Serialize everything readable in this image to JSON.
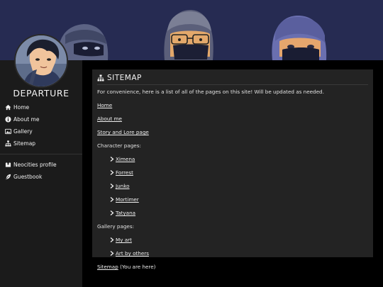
{
  "site": {
    "title": "DEPARTURE"
  },
  "sidebar": {
    "items": [
      {
        "label": "Home",
        "icon": "home-icon"
      },
      {
        "label": "About me",
        "icon": "info-icon"
      },
      {
        "label": "Gallery",
        "icon": "gallery-icon"
      },
      {
        "label": "Sitemap",
        "icon": "sitemap-icon"
      }
    ],
    "extra_items": [
      {
        "label": "Neocities profile",
        "icon": "neocities-icon"
      },
      {
        "label": "Guestbook",
        "icon": "feather-icon"
      }
    ]
  },
  "main": {
    "heading": "SITEMAP",
    "intro": "For convenience, here is a list of all of the pages on this site! Will be updated as needed.",
    "home_link": "Home",
    "about_link": "About me",
    "story_link": "Story and Lore page",
    "character_label": "Character pages:",
    "characters": [
      "Ximena",
      "Forrest",
      "Junko",
      "Mortimer",
      "Tatyana"
    ],
    "gallery_label": "Gallery pages:",
    "gallery_pages": [
      "My art",
      "Art by others"
    ],
    "sitemap_link": "Sitemap",
    "sitemap_note": " (You are here)"
  },
  "colors": {
    "banner": "#262b52",
    "sidebar": "#1b1b1b",
    "panel": "#232323",
    "background": "#000000"
  }
}
